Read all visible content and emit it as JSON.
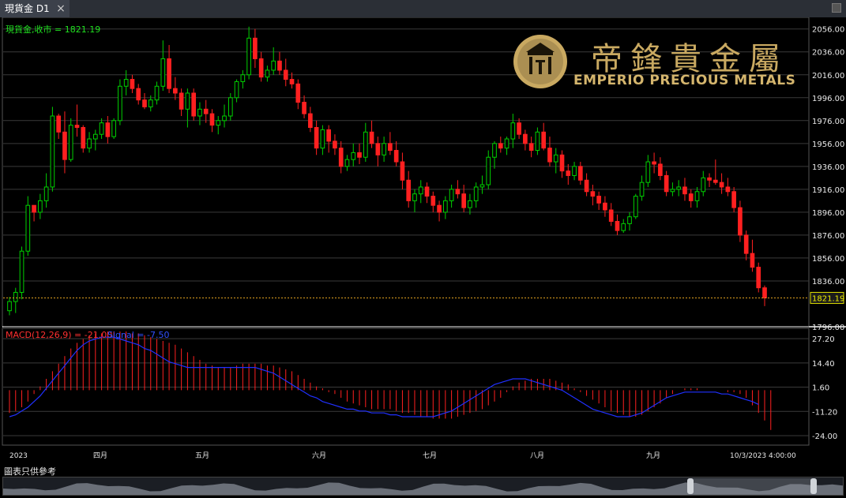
{
  "tab": {
    "title": "現貨金 D1",
    "close_icon": "close-icon"
  },
  "logo": {
    "name_cn": "帝鋒貴金屬",
    "name_en": "EMPERIO PRECIOUS METALS",
    "icon": "emblem-icon"
  },
  "disclaimer": "圖表只供參考",
  "chart_data": [
    {
      "type": "candlestick",
      "legend": "現貨金,收市 = 1821.19",
      "last_price_label": "1821.19",
      "ylim": [
        1796,
        2062
      ],
      "yticks": [
        "2056.00",
        "2036.00",
        "2016.00",
        "1996.00",
        "1976.00",
        "1956.00",
        "1936.00",
        "1916.00",
        "1896.00",
        "1876.00",
        "1856.00",
        "1836.00",
        "1796.00"
      ],
      "ytick_values": [
        2056,
        2036,
        2016,
        1996,
        1976,
        1956,
        1936,
        1916,
        1896,
        1876,
        1856,
        1836,
        1796
      ],
      "xticks": [
        "2023",
        "四月",
        "五月",
        "六月",
        "七月",
        "八月",
        "九月",
        "10/3/2023 4:00:00"
      ],
      "x_start": "2023-03-13",
      "up_color": "#00d000",
      "down_color": "#ff2020",
      "ohlc": [
        [
          1810,
          1822,
          1806,
          1818
        ],
        [
          1818,
          1830,
          1808,
          1826
        ],
        [
          1826,
          1866,
          1820,
          1862
        ],
        [
          1862,
          1910,
          1858,
          1902
        ],
        [
          1902,
          1900,
          1888,
          1896
        ],
        [
          1896,
          1912,
          1890,
          1906
        ],
        [
          1906,
          1930,
          1900,
          1918
        ],
        [
          1918,
          1988,
          1914,
          1980
        ],
        [
          1980,
          1982,
          1960,
          1966
        ],
        [
          1966,
          1984,
          1930,
          1942
        ],
        [
          1942,
          1978,
          1940,
          1972
        ],
        [
          1972,
          1990,
          1962,
          1970
        ],
        [
          1970,
          1972,
          1948,
          1952
        ],
        [
          1952,
          1966,
          1948,
          1960
        ],
        [
          1960,
          1968,
          1950,
          1964
        ],
        [
          1964,
          1978,
          1960,
          1974
        ],
        [
          1974,
          1980,
          1956,
          1962
        ],
        [
          1962,
          1978,
          1960,
          1976
        ],
        [
          1976,
          2012,
          1972,
          2006
        ],
        [
          2006,
          2020,
          1998,
          2012
        ],
        [
          2012,
          2016,
          2000,
          2004
        ],
        [
          2004,
          2008,
          1990,
          1994
        ],
        [
          1994,
          2000,
          1986,
          1988
        ],
        [
          1988,
          1998,
          1984,
          1994
        ],
        [
          1994,
          2010,
          1990,
          2006
        ],
        [
          2006,
          2046,
          2002,
          2030
        ],
        [
          2030,
          2042,
          2000,
          2004
        ],
        [
          2004,
          2014,
          1994,
          2000
        ],
        [
          2000,
          2004,
          1980,
          1986
        ],
        [
          1986,
          2004,
          1970,
          2000
        ],
        [
          2000,
          2004,
          1976,
          1980
        ],
        [
          1980,
          1992,
          1972,
          1986
        ],
        [
          1986,
          1994,
          1974,
          1982
        ],
        [
          1982,
          1986,
          1966,
          1972
        ],
        [
          1972,
          1980,
          1964,
          1976
        ],
        [
          1976,
          1990,
          1970,
          1980
        ],
        [
          1980,
          2000,
          1976,
          1996
        ],
        [
          1996,
          2012,
          1992,
          2010
        ],
        [
          2010,
          2020,
          2004,
          2016
        ],
        [
          2016,
          2058,
          2012,
          2048
        ],
        [
          2048,
          2056,
          2022,
          2030
        ],
        [
          2030,
          2036,
          2010,
          2014
        ],
        [
          2014,
          2024,
          2010,
          2020
        ],
        [
          2020,
          2040,
          2016,
          2028
        ],
        [
          2028,
          2036,
          2016,
          2020
        ],
        [
          2020,
          2030,
          2006,
          2012
        ],
        [
          2012,
          2018,
          2004,
          2008
        ],
        [
          2008,
          2012,
          1986,
          1992
        ],
        [
          1992,
          1998,
          1978,
          1982
        ],
        [
          1982,
          1988,
          1966,
          1970
        ],
        [
          1970,
          1976,
          1946,
          1952
        ],
        [
          1952,
          1972,
          1946,
          1968
        ],
        [
          1968,
          1972,
          1948,
          1958
        ],
        [
          1958,
          1964,
          1946,
          1952
        ],
        [
          1952,
          1958,
          1930,
          1936
        ],
        [
          1936,
          1946,
          1932,
          1942
        ],
        [
          1942,
          1956,
          1936,
          1948
        ],
        [
          1948,
          1956,
          1938,
          1944
        ],
        [
          1944,
          1974,
          1940,
          1966
        ],
        [
          1966,
          1976,
          1952,
          1956
        ],
        [
          1956,
          1962,
          1936,
          1946
        ],
        [
          1946,
          1962,
          1940,
          1956
        ],
        [
          1956,
          1966,
          1946,
          1950
        ],
        [
          1950,
          1958,
          1936,
          1940
        ],
        [
          1940,
          1948,
          1916,
          1924
        ],
        [
          1924,
          1932,
          1900,
          1906
        ],
        [
          1906,
          1916,
          1896,
          1912
        ],
        [
          1912,
          1924,
          1904,
          1918
        ],
        [
          1918,
          1922,
          1904,
          1910
        ],
        [
          1910,
          1914,
          1896,
          1902
        ],
        [
          1902,
          1906,
          1888,
          1896
        ],
        [
          1896,
          1910,
          1890,
          1906
        ],
        [
          1906,
          1920,
          1900,
          1916
        ],
        [
          1916,
          1924,
          1908,
          1912
        ],
        [
          1912,
          1920,
          1896,
          1900
        ],
        [
          1900,
          1912,
          1894,
          1906
        ],
        [
          1906,
          1922,
          1900,
          1918
        ],
        [
          1918,
          1928,
          1912,
          1920
        ],
        [
          1920,
          1950,
          1916,
          1944
        ],
        [
          1944,
          1958,
          1934,
          1956
        ],
        [
          1956,
          1962,
          1948,
          1952
        ],
        [
          1952,
          1962,
          1946,
          1960
        ],
        [
          1960,
          1982,
          1952,
          1974
        ],
        [
          1974,
          1978,
          1960,
          1964
        ],
        [
          1964,
          1968,
          1950,
          1956
        ],
        [
          1956,
          1962,
          1944,
          1950
        ],
        [
          1950,
          1970,
          1946,
          1966
        ],
        [
          1966,
          1974,
          1950,
          1952
        ],
        [
          1952,
          1962,
          1936,
          1940
        ],
        [
          1940,
          1952,
          1930,
          1946
        ],
        [
          1946,
          1950,
          1926,
          1932
        ],
        [
          1932,
          1938,
          1920,
          1928
        ],
        [
          1928,
          1940,
          1924,
          1936
        ],
        [
          1936,
          1940,
          1920,
          1924
        ],
        [
          1924,
          1930,
          1910,
          1914
        ],
        [
          1914,
          1920,
          1902,
          1910
        ],
        [
          1910,
          1914,
          1898,
          1904
        ],
        [
          1904,
          1910,
          1892,
          1898
        ],
        [
          1898,
          1904,
          1884,
          1888
        ],
        [
          1888,
          1894,
          1876,
          1880
        ],
        [
          1880,
          1890,
          1878,
          1886
        ],
        [
          1886,
          1896,
          1880,
          1892
        ],
        [
          1892,
          1912,
          1890,
          1910
        ],
        [
          1910,
          1928,
          1906,
          1922
        ],
        [
          1922,
          1946,
          1918,
          1940
        ],
        [
          1940,
          1948,
          1930,
          1938
        ],
        [
          1938,
          1944,
          1924,
          1928
        ],
        [
          1928,
          1932,
          1910,
          1914
        ],
        [
          1914,
          1922,
          1910,
          1916
        ],
        [
          1916,
          1924,
          1910,
          1918
        ],
        [
          1918,
          1926,
          1906,
          1912
        ],
        [
          1912,
          1916,
          1900,
          1906
        ],
        [
          1906,
          1918,
          1900,
          1914
        ],
        [
          1914,
          1932,
          1910,
          1926
        ],
        [
          1926,
          1930,
          1918,
          1924
        ],
        [
          1924,
          1942,
          1920,
          1922
        ],
        [
          1922,
          1930,
          1912,
          1918
        ],
        [
          1918,
          1926,
          1910,
          1914
        ],
        [
          1914,
          1918,
          1896,
          1900
        ],
        [
          1900,
          1906,
          1870,
          1876
        ],
        [
          1876,
          1880,
          1854,
          1860
        ],
        [
          1860,
          1872,
          1844,
          1848
        ],
        [
          1848,
          1852,
          1826,
          1830
        ],
        [
          1830,
          1832,
          1814,
          1821.19
        ]
      ]
    },
    {
      "type": "bar",
      "legend_macd": "MACD(12,26,9) = -21.00",
      "legend_signal": "Signal = -7.50",
      "ylim": [
        -29,
        31
      ],
      "yticks": [
        "27.20",
        "14.40",
        "1.60",
        "-11.20",
        "-24.00"
      ],
      "ytick_values": [
        27.2,
        14.4,
        1.6,
        -11.2,
        -24.0
      ],
      "macd_color": "#ff2020",
      "signal_color": "#2030ff",
      "macd": [
        -12,
        -11,
        -9,
        -6,
        -2,
        2,
        6,
        10,
        14,
        18,
        22,
        25,
        27,
        29,
        30,
        30,
        31,
        31,
        31,
        31,
        30,
        30,
        29,
        28,
        27,
        26,
        25,
        24,
        22,
        20,
        18,
        16,
        14,
        13,
        12,
        12,
        12,
        13,
        14,
        14,
        14,
        14,
        13,
        13,
        12,
        11,
        10,
        8,
        6,
        4,
        2,
        1,
        -1,
        -2,
        -4,
        -6,
        -7,
        -8,
        -9,
        -10,
        -10,
        -10,
        -10,
        -11,
        -12,
        -12,
        -13,
        -14,
        -14,
        -15,
        -15,
        -15,
        -15,
        -14,
        -13,
        -12,
        -11,
        -10,
        -8,
        -6,
        -4,
        -1,
        2,
        4,
        5,
        6,
        6,
        6,
        6,
        5,
        4,
        3,
        1,
        -1,
        -3,
        -5,
        -7,
        -9,
        -11,
        -12,
        -13,
        -14,
        -14,
        -13,
        -11,
        -9,
        -7,
        -4,
        -2,
        0,
        1,
        1,
        1,
        0,
        0,
        0,
        0,
        -1,
        -1,
        -2,
        -4,
        -8,
        -12,
        -16,
        -21
      ],
      "signal": [
        -14,
        -13,
        -11,
        -9,
        -6,
        -3,
        1,
        5,
        9,
        13,
        17,
        21,
        24,
        26,
        27,
        28,
        28,
        28,
        27,
        26,
        25,
        24,
        22,
        21,
        19,
        17,
        15,
        14,
        13,
        12,
        12,
        12,
        12,
        12,
        12,
        12,
        12,
        12,
        12,
        12,
        12,
        11,
        10,
        9,
        7,
        5,
        3,
        1,
        -1,
        -3,
        -4,
        -6,
        -7,
        -8,
        -9,
        -10,
        -10,
        -11,
        -11,
        -12,
        -12,
        -12,
        -13,
        -13,
        -14,
        -14,
        -14,
        -14,
        -14,
        -14,
        -13,
        -12,
        -11,
        -9,
        -7,
        -5,
        -3,
        -1,
        1,
        3,
        4,
        5,
        6,
        6,
        6,
        5,
        4,
        3,
        2,
        1,
        0,
        -2,
        -4,
        -6,
        -8,
        -10,
        -11,
        -12,
        -13,
        -14,
        -14,
        -14,
        -13,
        -12,
        -10,
        -8,
        -6,
        -4,
        -3,
        -2,
        -1,
        -1,
        -1,
        -1,
        -1,
        -1,
        -2,
        -2,
        -3,
        -4,
        -5,
        -6,
        -7.5
      ]
    }
  ]
}
